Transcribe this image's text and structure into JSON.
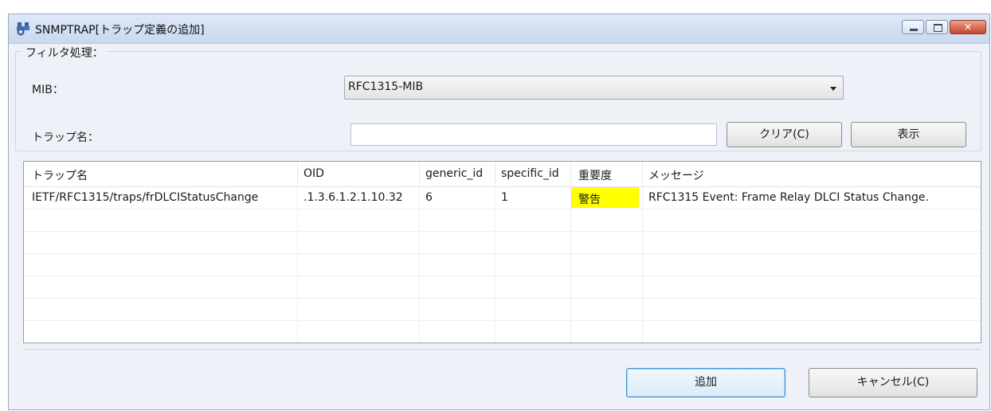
{
  "window": {
    "title": "SNMPTRAP[トラップ定義の追加]",
    "icon": "snmp-trap-app-icon",
    "controls": {
      "minimize": "minimize-icon",
      "maximize": "maximize-icon",
      "close": "close-icon"
    }
  },
  "filter": {
    "group_title": "フィルタ処理：",
    "mib_label": "MIB：",
    "mib_value": "RFC1315-MIB",
    "trap_name_label": "トラップ名：",
    "trap_name_value": "",
    "clear_button": "クリア(C)",
    "show_button": "表示"
  },
  "table": {
    "columns": [
      "トラップ名",
      "OID",
      "generic_id",
      "specific_id",
      "重要度",
      "メッセージ"
    ],
    "rows": [
      {
        "trap_name": "IETF/RFC1315/traps/frDLCIStatusChange",
        "oid": ".1.3.6.1.2.1.10.32",
        "generic_id": "6",
        "specific_id": "1",
        "severity": "警告",
        "message": "RFC1315 Event: Frame Relay DLCI Status Change."
      }
    ],
    "severity_color": "#ffff00"
  },
  "footer": {
    "add_button": "追加",
    "cancel_button": "キャンセル(C)"
  }
}
